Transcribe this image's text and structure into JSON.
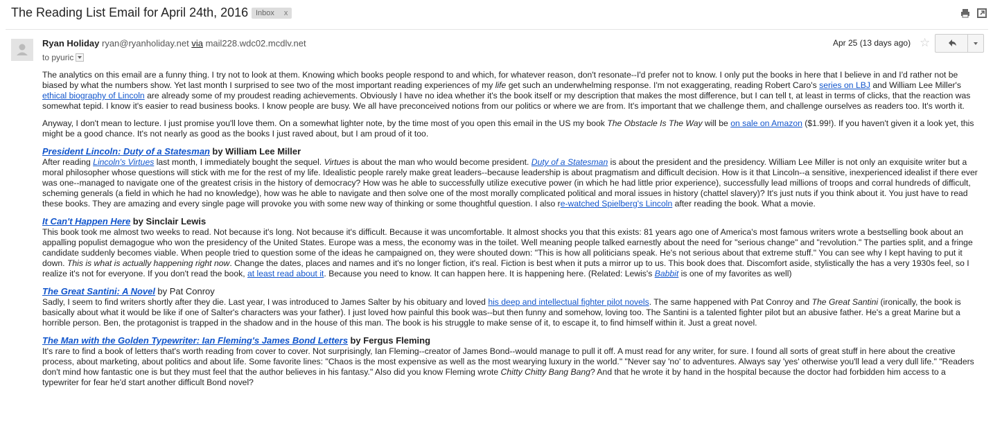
{
  "subject": "The Reading List Email for April 24th, 2016",
  "inbox_label": "Inbox",
  "inbox_label_close": "x",
  "icons": {
    "print": "print-icon",
    "new_window": "new-window-icon",
    "star": "star-icon",
    "reply": "reply-icon",
    "more": "chevron-down-icon"
  },
  "sender": {
    "name": "Ryan Holiday",
    "email": "ryan@ryanholiday.net",
    "via": "via",
    "via_domain": "mail228.wdc02.mcdlv.net",
    "to": "to pyuric"
  },
  "date": "Apr 25 (13 days ago)",
  "intro": [
    [
      {
        "t": "The analytics on this email are a funny thing. I try not to look at them. Knowing which books people respond to and which, for whatever reason, don't resonate--I'd prefer not to know. I only put the books in here that I believe in and I'd rather not be biased by what the numbers show. Yet last month I  surprised to see two of the most important reading experiences of my "
      },
      {
        "t": "life",
        "i": true
      },
      {
        "t": " get such an underwhelming response. I'm not exaggerating, reading Robert Caro's "
      },
      {
        "t": "series on LBJ",
        "l": true
      },
      {
        "t": " and William Lee Miller's "
      },
      {
        "t": "ethical biography of Lincoln",
        "l": true
      },
      {
        "t": " are already some of my proudest reading achievements. Obviously I have no idea whether it's the book itself or my description that makes the most difference, but I can tell t, at least in terms of clicks, that the reaction was somewhat tepid. I know it's easier to read business books. I know people are busy. We all have preconceived notions from our politics or where we are from. It's important that we challenge them, and challenge ourselves as readers too. It's worth it."
      }
    ],
    [
      {
        "t": "Anyway, I don't mean to lecture. I just promise you'll love them. On a somewhat lighter note, by the time most of you open this email in the US my book "
      },
      {
        "t": "The Obstacle Is The Way",
        "i": true
      },
      {
        "t": " will be "
      },
      {
        "t": "on sale on Amazon",
        "l": true
      },
      {
        "t": " ($1.99!). If you haven't given it a look yet, this might be a good chance. It's not nearly as good as the books I just raved about, but I am proud of it too."
      }
    ]
  ],
  "books": [
    {
      "title": "President Lincoln: Duty of a Statesman",
      "author": "by William Lee Miller",
      "body": [
        {
          "t": "After reading "
        },
        {
          "t": "Lincoln's Virtues",
          "l": true,
          "i": true
        },
        {
          "t": " last month, I immediately bought the sequel. "
        },
        {
          "t": "Virtues",
          "i": true
        },
        {
          "t": " is about the man who would become president. "
        },
        {
          "t": "Duty of a Statesman",
          "l": true,
          "i": true
        },
        {
          "t": " is about the president and the presidency. William Lee Miller is not only an exquisite writer but a moral philosopher whose questions will stick with me for the rest of my life. Idealistic people rarely make great leaders--because leadership is about pragmatism and difficult decision. How is it that Lincoln--a sensitive, inexperienced idealist if there ever was one--managed to navigate one of the greatest crisis in the history of democracy? How was he able to successfully utilize executive power (in which he had little prior experience), successfully lead millions of troops and corral hundreds of difficult, scheming generals (a field in which he had no knowledge), how was he able to navigate and then solve one of the most morally complicated political and moral issues in history (chattel slavery)? It's just nuts if you think about it. You just have to read these books. They are amazing and every single page will provoke you with some new way of thinking or some thoughtful question. I also r"
        },
        {
          "t": "e-watched Spielberg's Lincoln",
          "l": true
        },
        {
          "t": " after reading the book. What a movie."
        }
      ]
    },
    {
      "title": "It Can't Happen Here",
      "author": "by Sinclair Lewis",
      "body": [
        {
          "t": "This book took me almost two weeks to read. Not because it's long. Not because it's difficult. Because it was uncomfortable. It almost shocks you that this exists: 81 years ago one of America's most famous writers wrote a bestselling book about an appalling populist demagogue who won the presidency of the United States. Europe was a mess, the economy was in the toilet. Well meaning people talked earnestly about the need for \"serious change\" and \"revolution.\" The parties split, and a fringe candidate suddenly becomes viable. When people tried to question some of the ideas he campaigned on, they were shouted down: \"This is how all politicians speak. He's not serious about that extreme stuff.\" You can see why I kept having to put it down. "
        },
        {
          "t": "This is what is actually happening right now",
          "i": true
        },
        {
          "t": ". Change the dates, places and names and it's no longer fiction, it's real. Fiction is best when it puts a mirror up to us. This book does that. Discomfort aside, stylistically the has a very 1930s feel, so I realize it's not for everyone. If you don't read the book, "
        },
        {
          "t": "at least read about it",
          "l": true
        },
        {
          "t": ". Because you need to know. It can happen here. It is happening here. (Related: Lewis's "
        },
        {
          "t": "Babbit",
          "l": true,
          "i": true
        },
        {
          "t": " is one of my favorites as well)"
        }
      ]
    },
    {
      "title": "The Great Santini: A Novel",
      "author": "by Pat Conroy",
      "author_plain": true,
      "body": [
        {
          "t": "Sadly, I seem to find writers shortly after they die. Last year, I was introduced to James Salter by his obituary and loved "
        },
        {
          "t": "his deep and intellectual fighter pilot novels",
          "l": true
        },
        {
          "t": ". The same happened with Pat Conroy and "
        },
        {
          "t": "The Great Santini",
          "i": true
        },
        {
          "t": " (ironically, the book is basically about what it would be like if one of Salter's characters was your father). I just loved how painful this book was--but then funny and somehow, loving too. The Santini is a talented fighter pilot but an abusive father. He's a great Marine but a horrible person. Ben, the protagonist is trapped in the shadow and in the house of this man. The book is his struggle to make sense of it, to escape it, to find himself within it. Just a great novel."
        }
      ]
    },
    {
      "title": "The Man with the Golden Typewriter: Ian Fleming's James Bond Letters",
      "author": "by Fergus Fleming",
      "body": [
        {
          "t": "It's rare to find a book of letters that's worth reading from cover to cover. Not surprisingly, Ian Fleming--creator of James Bond--would manage to pull it off. A must read for any writer, for sure. I found all sorts of great stuff in here about the creative process, about marketing, about politics and about life. Some favorite lines: \"Chaos is the most expensive as well as the most wearying luxury in the world.\" \"Never say 'no' to adventures. Always say 'yes' otherwise you'll lead a very dull life.\" \"Readers don't mind how fantastic one is but they must feel that the author believes in his fantasy.\" Also did you know Fleming wrote "
        },
        {
          "t": "Chitty Chitty Bang Bang",
          "i": true
        },
        {
          "t": "? And that he wrote it by hand in the hospital because the doctor had forbidden him access to a typewriter for fear he'd start another difficult Bond novel?"
        }
      ]
    }
  ]
}
